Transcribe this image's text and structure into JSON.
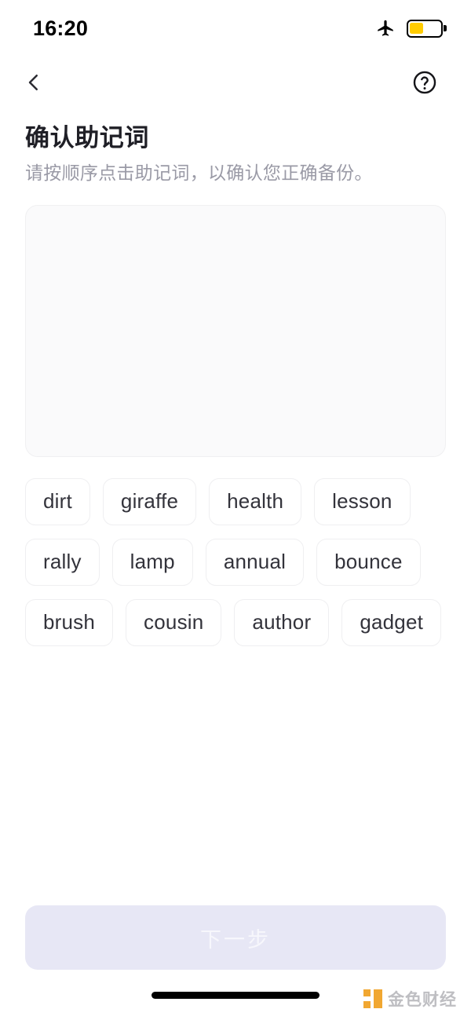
{
  "status_bar": {
    "time": "16:20",
    "airplane_icon": "airplane-mode-icon",
    "battery_icon": "battery-icon",
    "battery_level_percent": 45,
    "battery_fill_color": "#ffcc00"
  },
  "nav_bar": {
    "back_icon": "chevron-left-icon",
    "help_icon": "question-circle-icon"
  },
  "header": {
    "title": "确认助记词",
    "subtitle": "请按顺序点击助记词，以确认您正确备份。"
  },
  "answer_area": {
    "name": "selected-words-area",
    "selected_words": []
  },
  "word_bank": {
    "words": [
      "dirt",
      "giraffe",
      "health",
      "lesson",
      "rally",
      "lamp",
      "annual",
      "bounce",
      "brush",
      "cousin",
      "author",
      "gadget"
    ]
  },
  "footer": {
    "next_label": "下一步",
    "next_disabled": true,
    "next_bg_color": "#e7e7f5",
    "next_text_color": "#f7f7fc"
  },
  "watermark": {
    "text": "金色财经",
    "logo_color": "#f0a020"
  }
}
